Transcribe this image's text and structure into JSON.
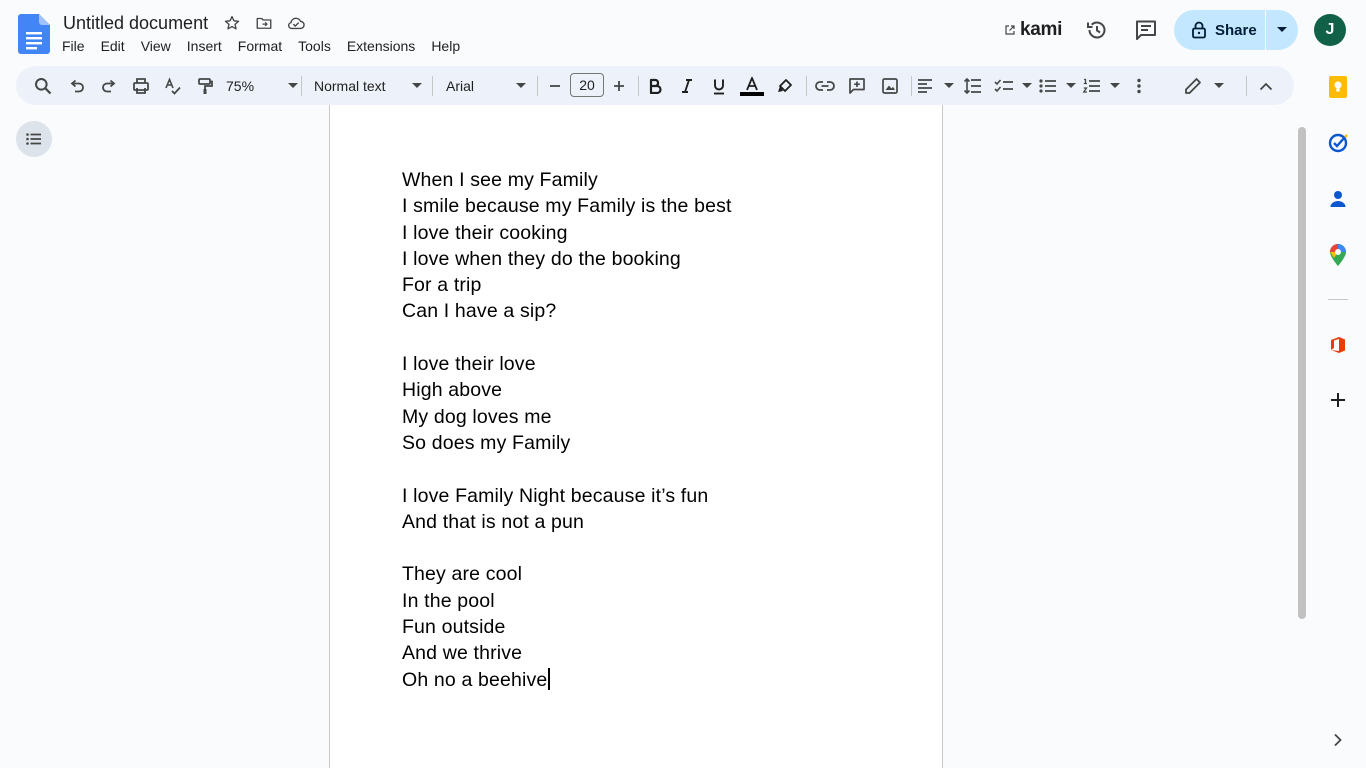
{
  "header": {
    "title": "Untitled document",
    "menu": [
      "File",
      "Edit",
      "View",
      "Insert",
      "Format",
      "Tools",
      "Extensions",
      "Help"
    ],
    "kami_label": "kami",
    "share_label": "Share",
    "avatar_initial": "J"
  },
  "toolbar": {
    "zoom": "75%",
    "style": "Normal text",
    "font": "Arial",
    "font_size": "20"
  },
  "document": {
    "lines": [
      "When I see my Family",
      "I smile because my Family is the best",
      "I love their cooking",
      "I love when they do the booking",
      "For a trip",
      "Can I have a sip?",
      "",
      "I love their love",
      "High above",
      "My dog loves me",
      "So does my Family",
      "",
      "I love Family Night because it’s fun",
      "And that is not a pun",
      "",
      "They are cool",
      "In the pool",
      "Fun outside",
      "And we thrive",
      "Oh no a beehive"
    ]
  },
  "colors": {
    "accent": "#0b57d0",
    "share_bg": "#c2e7ff",
    "toolbar_bg": "#edf2fa",
    "avatar_bg": "#116149"
  }
}
